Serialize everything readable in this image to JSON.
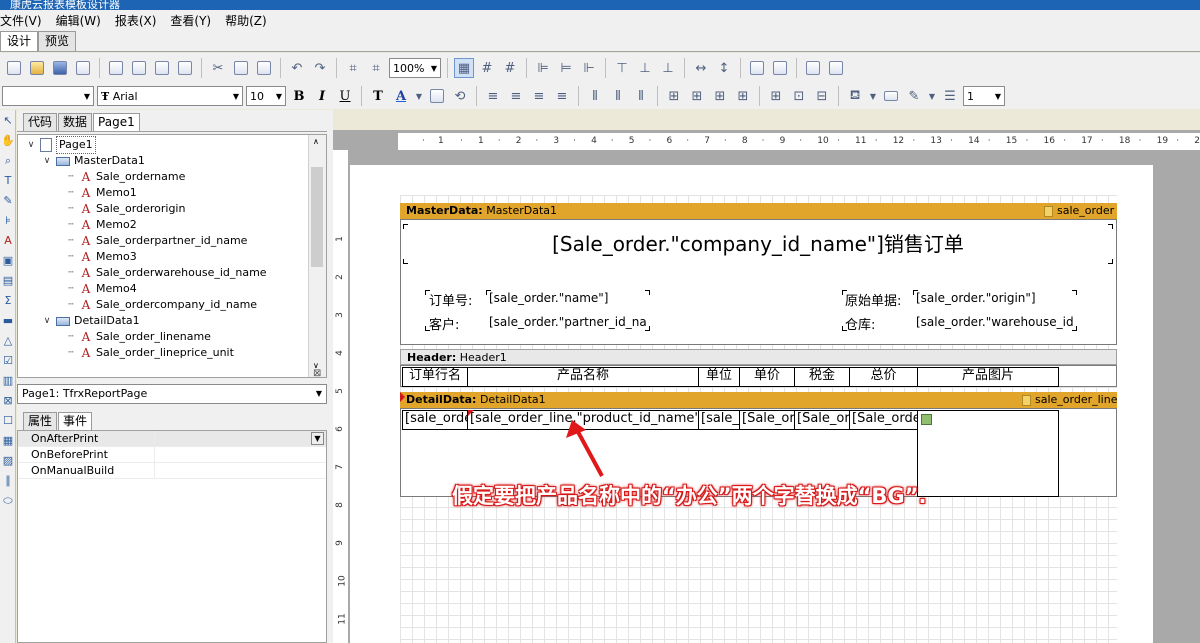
{
  "window": {
    "title": "康虎云报表模板设计器"
  },
  "menu": [
    "文件(V)",
    "编辑(W)",
    "报表(X)",
    "查看(Y)",
    "帮助(Z)"
  ],
  "mode_tabs": [
    "设计",
    "预览"
  ],
  "toolbar": {
    "zoom": "100%",
    "font_name": "Arial",
    "font_size": "10",
    "line_width": "1"
  },
  "panel_tabs": [
    "代码",
    "数据",
    "Page1"
  ],
  "tree": {
    "items": [
      {
        "label": "Page1",
        "icon": "page-icon",
        "indent": 0,
        "expander": "∨"
      },
      {
        "label": "MasterData1",
        "icon": "band-icon",
        "indent": 1,
        "expander": "∨"
      },
      {
        "label": "Sale_ordername",
        "icon": "memo-icon",
        "indent": 2,
        "expander": ""
      },
      {
        "label": "Memo1",
        "icon": "memo-icon",
        "indent": 2,
        "expander": ""
      },
      {
        "label": "Sale_orderorigin",
        "icon": "memo-icon",
        "indent": 2,
        "expander": ""
      },
      {
        "label": "Memo2",
        "icon": "memo-icon",
        "indent": 2,
        "expander": ""
      },
      {
        "label": "Sale_orderpartner_id_name",
        "icon": "memo-icon",
        "indent": 2,
        "expander": ""
      },
      {
        "label": "Memo3",
        "icon": "memo-icon",
        "indent": 2,
        "expander": ""
      },
      {
        "label": "Sale_orderwarehouse_id_name",
        "icon": "memo-icon",
        "indent": 2,
        "expander": ""
      },
      {
        "label": "Memo4",
        "icon": "memo-icon",
        "indent": 2,
        "expander": ""
      },
      {
        "label": "Sale_ordercompany_id_name",
        "icon": "memo-icon",
        "indent": 2,
        "expander": ""
      },
      {
        "label": "DetailData1",
        "icon": "band-icon",
        "indent": 1,
        "expander": "∨"
      },
      {
        "label": "Sale_order_linename",
        "icon": "memo-icon",
        "indent": 2,
        "expander": ""
      },
      {
        "label": "Sale_order_lineprice_unit",
        "icon": "memo-icon",
        "indent": 2,
        "expander": ""
      }
    ]
  },
  "object_selector": "Page1: TfrxReportPage",
  "inspector_tabs": [
    "属性",
    "事件"
  ],
  "events": [
    "OnAfterPrint",
    "OnBeforePrint",
    "OnManualBuild"
  ],
  "ruler_numbers": [
    "1",
    "1",
    "2",
    "3",
    "4",
    "5",
    "6",
    "7",
    "8",
    "9",
    "10",
    "11",
    "12",
    "13",
    "14",
    "15",
    "16",
    "17",
    "18",
    "19",
    "20",
    "21"
  ],
  "vruler_numbers": [
    "1",
    "2",
    "3",
    "4",
    "5",
    "6",
    "7",
    "8",
    "9",
    "10",
    "11",
    "12"
  ],
  "report": {
    "master": {
      "band_type": "MasterData:",
      "band_name": "MasterData1",
      "dataset": "sale_order",
      "title": "[Sale_order.\"company_id_name\"]销售订单",
      "order_no_label": "订单号:",
      "order_no_value": "[sale_order.\"name\"]",
      "customer_label": "客户:",
      "customer_value": "[sale_order.\"partner_id_na",
      "origin_label": "原始单据:",
      "origin_value": "[sale_order.\"origin\"]",
      "warehouse_label": "仓库:",
      "warehouse_value": "[sale_order.\"warehouse_id"
    },
    "header": {
      "band_type": "Header:",
      "band_name": "Header1",
      "columns": [
        "订单行名",
        "产品名称",
        "单位",
        "单价",
        "税金",
        "总价",
        "产品图片"
      ]
    },
    "detail": {
      "band_type": "DetailData:",
      "band_name": "DetailData1",
      "dataset": "sale_order_line",
      "cells": [
        "[sale_orde",
        "[sale_order_line.\"product_id_name\"]",
        "[sale_",
        "[Sale_or",
        "[Sale_or",
        "[Sale_orde"
      ]
    }
  },
  "annotation": "假定要把产品名称中的“办公”两个字替换成“BG”.",
  "colors": {
    "band_header": "#e0a52a",
    "annotation_text": "#ffffff",
    "annotation_outline": "#d81818",
    "arrow": "#e01818"
  }
}
